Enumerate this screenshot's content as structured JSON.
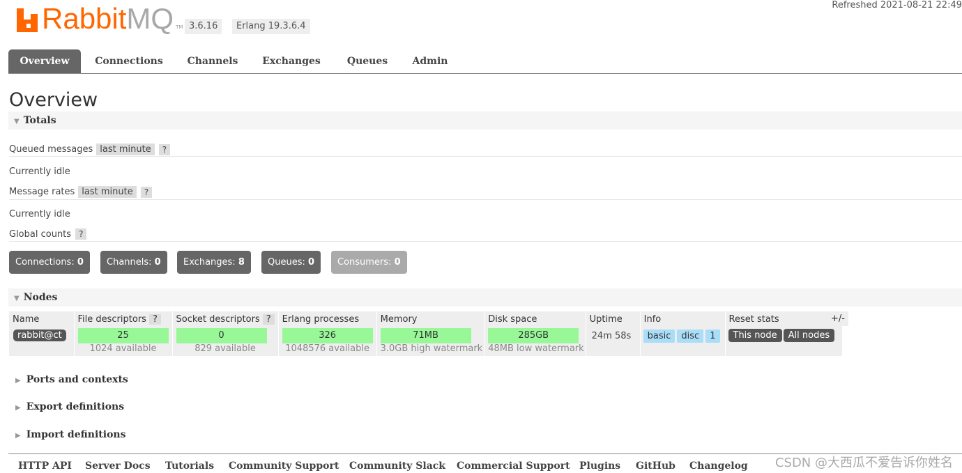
{
  "header": {
    "logo_main": "Rabbit",
    "logo_mq": "MQ",
    "logo_tm": "TM",
    "version": "3.6.16",
    "erlang": "Erlang 19.3.6.4",
    "refreshed": "Refreshed 2021-08-21 22:49"
  },
  "tabs": [
    "Overview",
    "Connections",
    "Channels",
    "Exchanges",
    "Queues",
    "Admin"
  ],
  "page_title": "Overview",
  "totals": {
    "section_label": "Totals",
    "queued_label": "Queued messages",
    "queued_range": "last minute",
    "help": "?",
    "queued_status": "Currently idle",
    "rates_label": "Message rates",
    "rates_range": "last minute",
    "rates_status": "Currently idle",
    "global_label": "Global counts"
  },
  "counts": [
    {
      "label": "Connections:",
      "value": "0"
    },
    {
      "label": "Channels:",
      "value": "0"
    },
    {
      "label": "Exchanges:",
      "value": "8"
    },
    {
      "label": "Queues:",
      "value": "0"
    },
    {
      "label": "Consumers:",
      "value": "0"
    }
  ],
  "nodes": {
    "section_label": "Nodes",
    "columns": [
      "Name",
      "File descriptors",
      "Socket descriptors",
      "Erlang processes",
      "Memory",
      "Disk space",
      "Uptime",
      "Info",
      "Reset stats"
    ],
    "plus_minus": "+/-",
    "row": {
      "name": "rabbit@ct",
      "fd_used": "25",
      "fd_avail": "1024 available",
      "sd_used": "0",
      "sd_avail": "829 available",
      "proc_used": "326",
      "proc_avail": "1048576 available",
      "mem_used": "71MB",
      "mem_sub": "3.0GB high watermark",
      "disk_used": "285GB",
      "disk_sub": "48MB low watermark",
      "uptime": "24m 58s",
      "info": [
        "basic",
        "disc",
        "1"
      ],
      "reset_this": "This node",
      "reset_all": "All nodes"
    }
  },
  "collapsed_sections": [
    "Ports and contexts",
    "Export definitions",
    "Import definitions"
  ],
  "footer": [
    "HTTP API",
    "Server Docs",
    "Tutorials",
    "Community Support",
    "Community Slack",
    "Commercial Support",
    "Plugins",
    "GitHub",
    "Changelog"
  ],
  "watermark": "CSDN @大西瓜不爱告诉你姓名",
  "colors": {
    "brand": "#ff6600",
    "bar_green": "#98f898",
    "info_blue": "#aaddf8",
    "tab_active": "#666666"
  }
}
